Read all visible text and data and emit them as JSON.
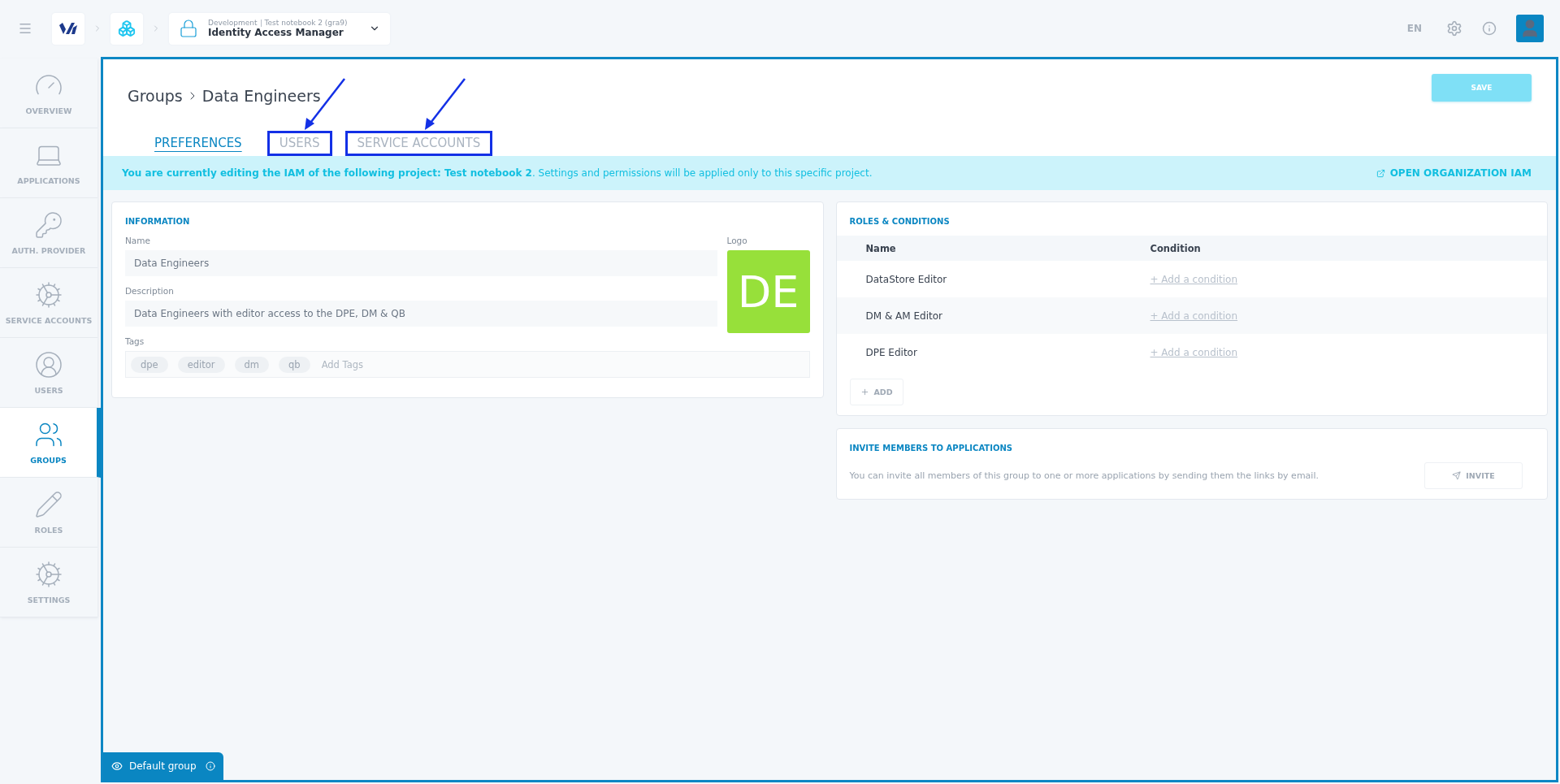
{
  "topbar": {
    "context": "Development",
    "project": "Test notebook 2 (gra9)",
    "app_title": "Identity Access Manager",
    "language": "EN"
  },
  "sidebar": {
    "items": [
      {
        "label": "OVERVIEW",
        "kind": "gauge",
        "selected": false
      },
      {
        "label": "APPLICATIONS",
        "kind": "laptop",
        "selected": false
      },
      {
        "label": "AUTH. PROVIDER",
        "kind": "key",
        "selected": false
      },
      {
        "label": "SERVICE ACCOUNTS",
        "kind": "gear",
        "selected": false
      },
      {
        "label": "USERS",
        "kind": "user",
        "selected": false
      },
      {
        "label": "GROUPS",
        "kind": "group",
        "selected": true
      },
      {
        "label": "ROLES",
        "kind": "pencil",
        "selected": false
      },
      {
        "label": "SETTINGS",
        "kind": "cogs",
        "selected": false
      }
    ]
  },
  "header": {
    "breadcrumb": [
      "Groups",
      "Data Engineers"
    ],
    "save": "SAVE"
  },
  "tabs": [
    {
      "label": "PREFERENCES",
      "selected": true,
      "highlighted": false
    },
    {
      "label": "USERS",
      "selected": false,
      "highlighted": true
    },
    {
      "label": "SERVICE ACCOUNTS",
      "selected": false,
      "highlighted": true
    }
  ],
  "banner": {
    "text": "**You are currently editing the IAM of the following project: Test notebook 2**. Settings and permissions will be applied only to this specific project.",
    "link": "OPEN ORGANIZATION IAM"
  },
  "information": {
    "title": "INFORMATION",
    "fields": [
      {
        "label": "Name",
        "value": "Data Engineers"
      },
      {
        "label": "Description",
        "value": "Data Engineers with editor access to the DPE, DM & QB"
      }
    ],
    "logo_label": "Logo",
    "logo_text": "DE",
    "tags_label": "Tags",
    "tags": [
      "dpe",
      "editor",
      "dm",
      "qb"
    ],
    "tags_placeholder": "Add Tags"
  },
  "roles": {
    "title": "ROLES & CONDITIONS",
    "columns": [
      "Name",
      "Condition"
    ],
    "rows": [
      {
        "name": "DataStore Editor",
        "condition": "+ Add a condition"
      },
      {
        "name": "DM & AM Editor",
        "condition": "+ Add a condition"
      },
      {
        "name": "DPE Editor",
        "condition": "+ Add a condition"
      }
    ],
    "add": "ADD"
  },
  "invite": {
    "title": "INVITE MEMBERS TO APPLICATIONS",
    "text": "You can invite all members of this group to one or more applications by sending them the links by email.",
    "button": "INVITE"
  },
  "footer_tab": {
    "label": "Default group"
  }
}
